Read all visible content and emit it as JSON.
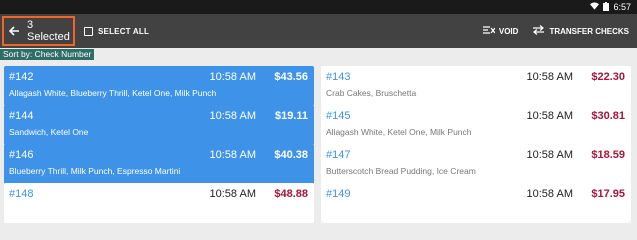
{
  "status": {
    "time": "6:57"
  },
  "toolbar": {
    "selected_label": "3 Selected",
    "select_all_label": "SELECT ALL",
    "void_label": "VOID",
    "transfer_label": "TRANSFER CHECKS"
  },
  "sort": {
    "label": "Sort by: Check Number"
  },
  "checks": [
    {
      "number": "#142",
      "time": "10:58 AM",
      "amount": "$43.56",
      "items": "Allagash White, Blueberry Thrill, Ketel One, Milk Punch",
      "selected": true
    },
    {
      "number": "#143",
      "time": "10:58 AM",
      "amount": "$22.30",
      "items": "Crab Cakes, Bruschetta",
      "selected": false
    },
    {
      "number": "#144",
      "time": "10:58 AM",
      "amount": "$19.11",
      "items": "Sandwich, Ketel One",
      "selected": true
    },
    {
      "number": "#145",
      "time": "10:58 AM",
      "amount": "$30.81",
      "items": "Allagash White, Ketel One, Milk Punch",
      "selected": false
    },
    {
      "number": "#146",
      "time": "10:58 AM",
      "amount": "$40.38",
      "items": "Blueberry Thrill, Milk Punch, Espresso Martini",
      "selected": true
    },
    {
      "number": "#147",
      "time": "10:58 AM",
      "amount": "$18.59",
      "items": "Butterscotch Bread Pudding, Ice Cream",
      "selected": false
    },
    {
      "number": "#148",
      "time": "10:58 AM",
      "amount": "$48.88",
      "items": "",
      "selected": false
    },
    {
      "number": "#149",
      "time": "10:58 AM",
      "amount": "$17.95",
      "items": "",
      "selected": false
    }
  ]
}
